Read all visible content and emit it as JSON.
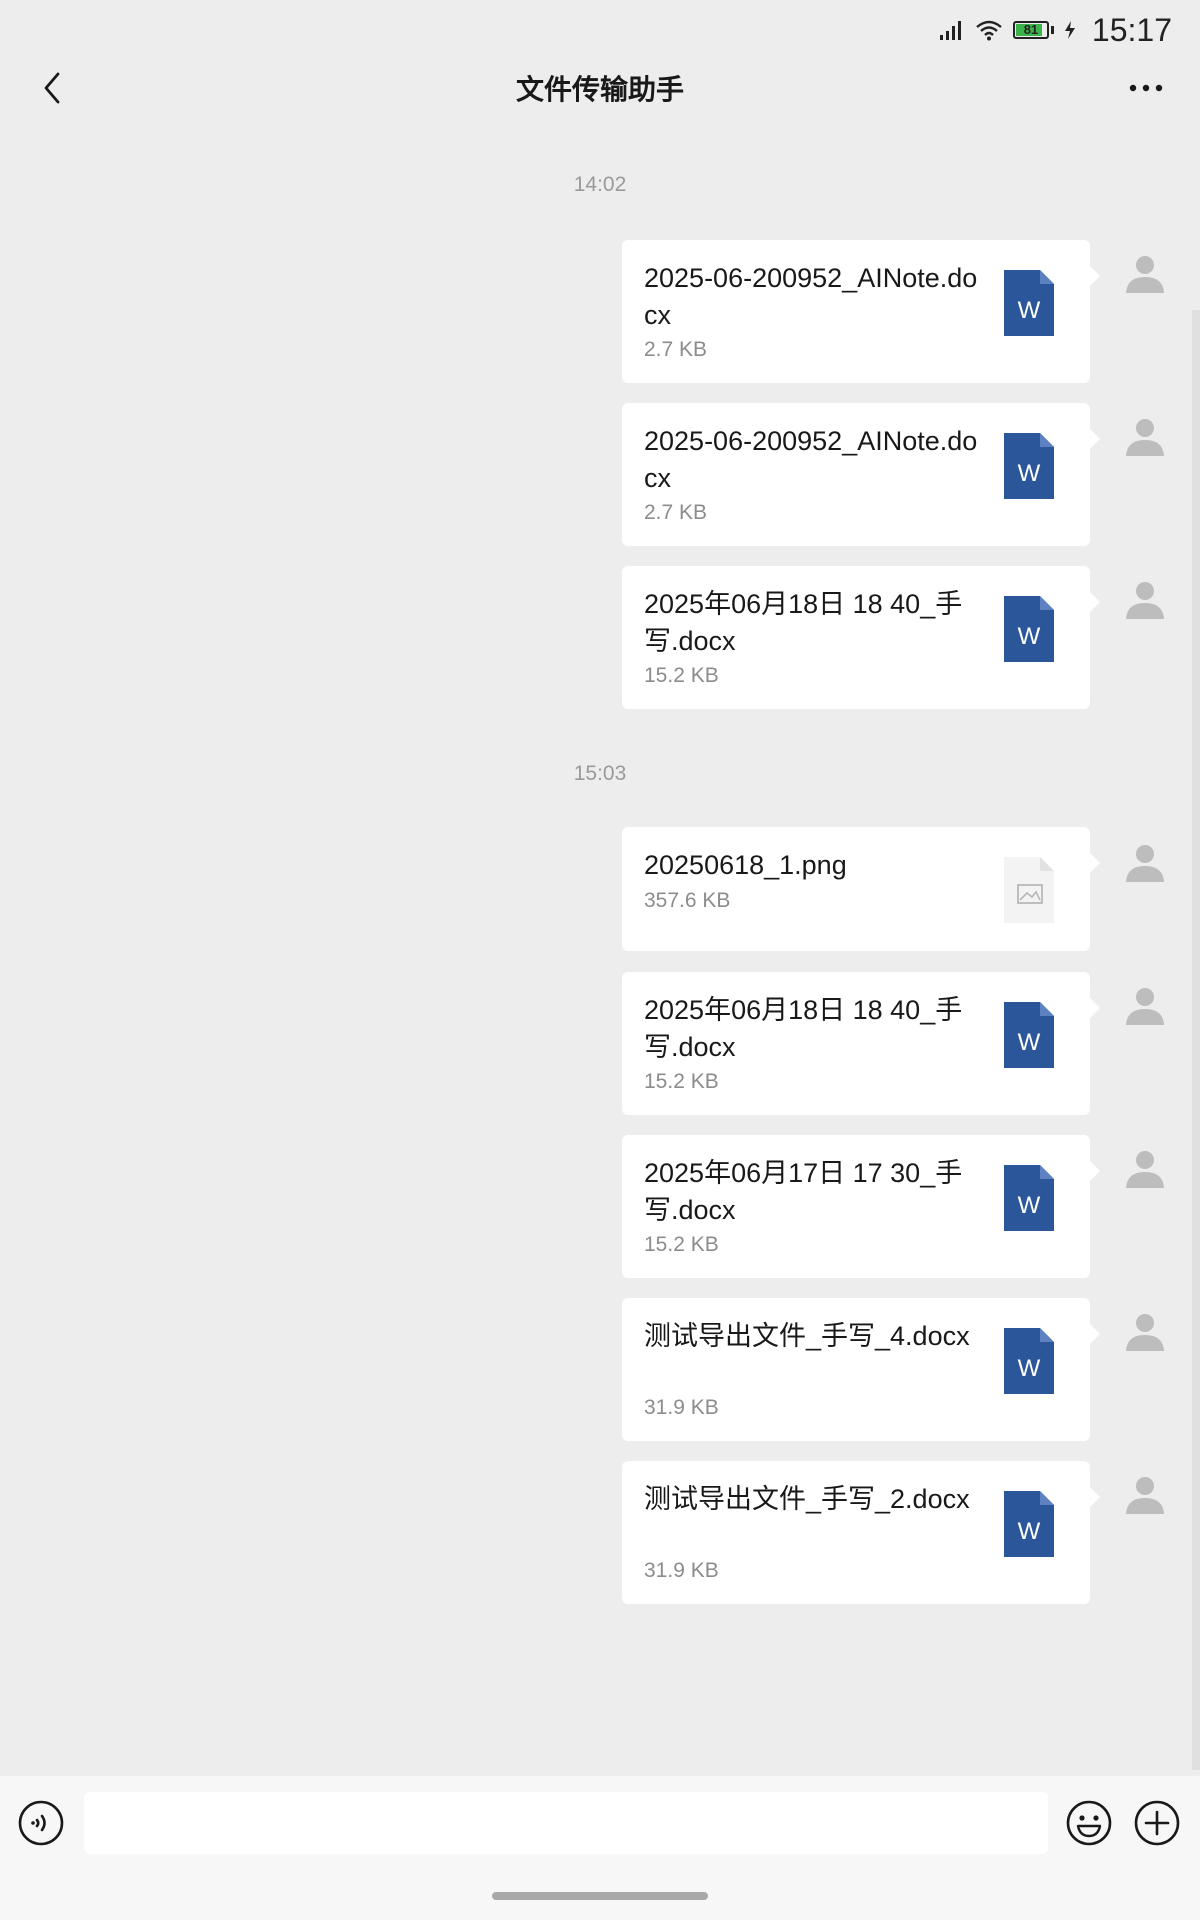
{
  "status_bar": {
    "battery_level": "81",
    "time": "15:17"
  },
  "header": {
    "title": "文件传输助手"
  },
  "chat": {
    "divider_1": "14:02",
    "divider_2": "15:03",
    "messages": [
      {
        "name": "2025-06-200952_AINote.docx",
        "size": "2.7 KB",
        "type": "word",
        "icon_letter": "W"
      },
      {
        "name": "2025-06-200952_AINote.docx",
        "size": "2.7 KB",
        "type": "word",
        "icon_letter": "W"
      },
      {
        "name": "2025年06月18日 18 40_手写.docx",
        "size": "15.2 KB",
        "type": "word",
        "icon_letter": "W"
      },
      {
        "name": "20250618_1.png",
        "size": "357.6 KB",
        "type": "image"
      },
      {
        "name": "2025年06月18日 18 40_手写.docx",
        "size": "15.2 KB",
        "type": "word",
        "icon_letter": "W"
      },
      {
        "name": "2025年06月17日 17 30_手写.docx",
        "size": "15.2 KB",
        "type": "word",
        "icon_letter": "W"
      },
      {
        "name": "测试导出文件_手写_4.docx",
        "size": "31.9 KB",
        "type": "word",
        "icon_letter": "W"
      },
      {
        "name": "测试导出文件_手写_2.docx",
        "size": "31.9 KB",
        "type": "word",
        "icon_letter": "W"
      }
    ]
  },
  "input_bar": {
    "placeholder": ""
  },
  "colors": {
    "background": "#EDEDED",
    "bubble": "#FFFFFF",
    "word_icon": "#2B579A",
    "avatar": "#BDBDBD",
    "battery": "#3BB34A"
  },
  "icons": {
    "back": "chevron-left-icon",
    "more": "more-dots-icon",
    "word": "word-file-icon",
    "image": "image-file-icon",
    "avatar": "default-avatar-icon",
    "voice": "voice-icon",
    "emoji": "emoji-icon",
    "plus": "plus-icon"
  }
}
